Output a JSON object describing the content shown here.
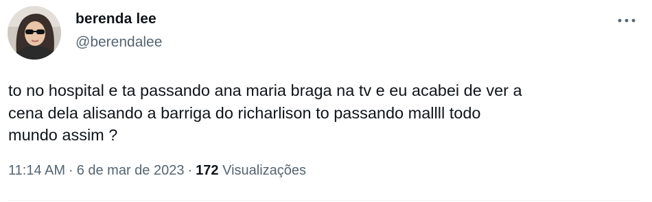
{
  "author": {
    "display_name": "berenda lee",
    "handle": "@berendalee"
  },
  "tweet": {
    "text": "to no hospital e ta passando ana maria braga na tv e eu acabei de ver a\ncena dela alisando a barriga do richarlison to passando mallll todo\nmundo assim ?"
  },
  "meta": {
    "time": "11:14 AM",
    "separator": "·",
    "date": "6 de mar de 2023",
    "views_count": "172",
    "views_label": "Visualizações"
  },
  "icons": {
    "more": "more-horizontal-icon"
  },
  "colors": {
    "text_primary": "#0f1419",
    "text_secondary": "#536471",
    "divider": "#eff3f4"
  }
}
